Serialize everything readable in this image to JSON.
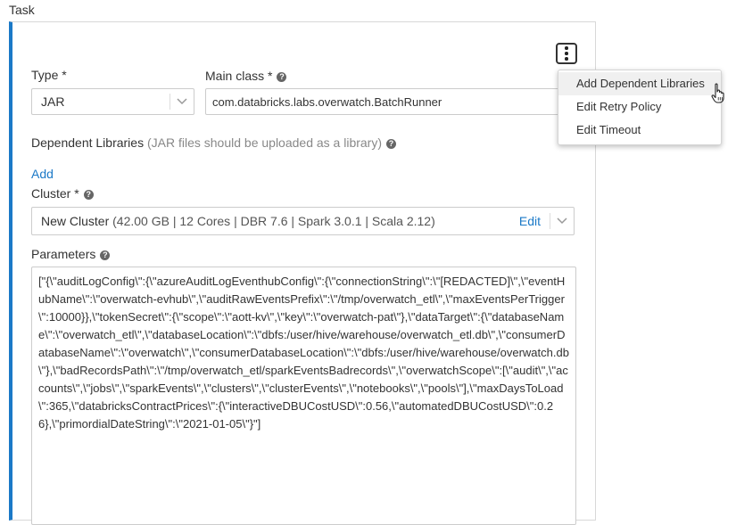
{
  "section": {
    "title": "Task"
  },
  "type_field": {
    "label": "Type *",
    "value": "JAR"
  },
  "main_class": {
    "label": "Main class *",
    "value": "com.databricks.labs.overwatch.BatchRunner"
  },
  "dependent_libraries": {
    "label": "Dependent Libraries",
    "hint": " (JAR files should be uploaded as a library)",
    "add_label": "Add"
  },
  "cluster": {
    "label": "Cluster *",
    "name": "New Cluster",
    "details": " (42.00 GB | 12 Cores | DBR 7.6 | Spark 3.0.1 | Scala 2.12)",
    "edit_label": "Edit"
  },
  "parameters": {
    "label": "Parameters",
    "value": "[\"{\\\"auditLogConfig\\\":{\\\"azureAuditLogEventhubConfig\\\":{\\\"connectionString\\\":\\\"[REDACTED]\\\",\\\"eventHubName\\\":\\\"overwatch-evhub\\\",\\\"auditRawEventsPrefix\\\":\\\"/tmp/overwatch_etl\\\",\\\"maxEventsPerTrigger\\\":10000}},\\\"tokenSecret\\\":{\\\"scope\\\":\\\"aott-kv\\\",\\\"key\\\":\\\"overwatch-pat\\\"},\\\"dataTarget\\\":{\\\"databaseName\\\":\\\"overwatch_etl\\\",\\\"databaseLocation\\\":\\\"dbfs:/user/hive/warehouse/overwatch_etl.db\\\",\\\"consumerDatabaseName\\\":\\\"overwatch\\\",\\\"consumerDatabaseLocation\\\":\\\"dbfs:/user/hive/warehouse/overwatch.db\\\"},\\\"badRecordsPath\\\":\\\"/tmp/overwatch_etl/sparkEventsBadrecords\\\",\\\"overwatchScope\\\":[\\\"audit\\\",\\\"accounts\\\",\\\"jobs\\\",\\\"sparkEvents\\\",\\\"clusters\\\",\\\"clusterEvents\\\",\\\"notebooks\\\",\\\"pools\\\"],\\\"maxDaysToLoad\\\":365,\\\"databricksContractPrices\\\":{\\\"interactiveDBUCostUSD\\\":0.56,\\\"automatedDBUCostUSD\\\":0.26},\\\"primordialDateString\\\":\\\"2021-01-05\\\"}\"]"
  },
  "menu": {
    "items": [
      {
        "label": "Add Dependent Libraries"
      },
      {
        "label": "Edit Retry Policy"
      },
      {
        "label": "Edit Timeout"
      }
    ]
  },
  "colors": {
    "accent": "#1b79c7",
    "border": "#cccccc",
    "text": "#333333"
  },
  "icons": {
    "kebab": "more-vertical-icon",
    "help": "question-circle-icon",
    "chevron": "chevron-down-icon",
    "cursor": "hand-pointer-icon"
  }
}
